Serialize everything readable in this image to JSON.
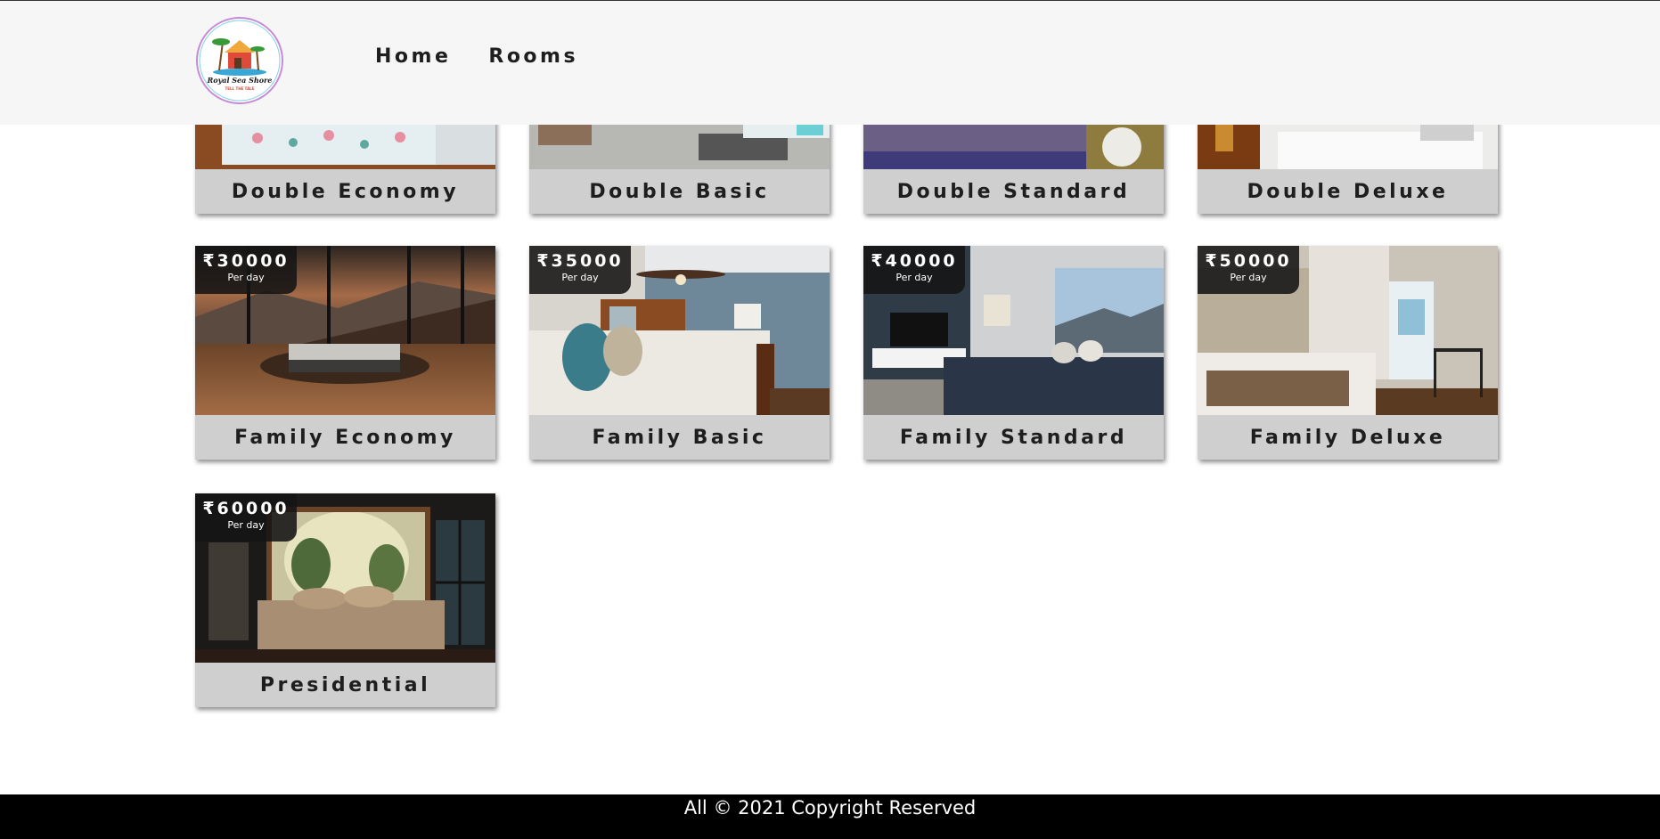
{
  "header": {
    "logo": {
      "name": "Royal Sea Shore",
      "tagline": "TELL THE TALE"
    },
    "nav": [
      {
        "label": "Home"
      },
      {
        "label": "Rooms"
      }
    ]
  },
  "rooms": [
    {
      "name": "Double Economy"
    },
    {
      "name": "Double Basic"
    },
    {
      "name": "Double Standard"
    },
    {
      "name": "Double Deluxe"
    },
    {
      "name": "Family Economy",
      "price": "₹30000",
      "per": "Per day"
    },
    {
      "name": "Family Basic",
      "price": "₹35000",
      "per": "Per day"
    },
    {
      "name": "Family Standard",
      "price": "₹40000",
      "per": "Per day"
    },
    {
      "name": "Family Deluxe",
      "price": "₹50000",
      "per": "Per day"
    },
    {
      "name": "Presidential",
      "price": "₹60000",
      "per": "Per day"
    }
  ],
  "footer": {
    "text": "All © 2021 Copyright Reserved"
  },
  "colors": {
    "header_bg": "#f6f6f6",
    "label_bar": "#cfcfcf",
    "footer_bg": "#000000",
    "price_badge": "#141414"
  }
}
